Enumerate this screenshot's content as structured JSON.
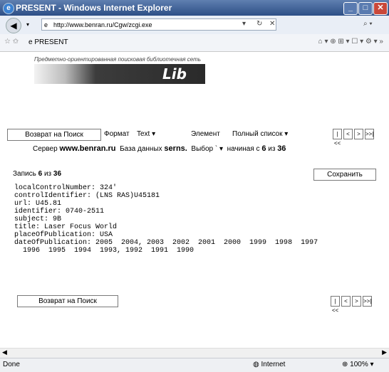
{
  "window": {
    "title": "PRESENT - Windows Internet Explorer"
  },
  "address_bar": {
    "url": "http://www.benran.ru/Cgw/zcgi.exe"
  },
  "tab": {
    "label": "PRESENT"
  },
  "page": {
    "slogan": "Предметно-ориентированная поисковая библиотечная сеть",
    "logo_text": "Lib",
    "back_button": "Возврат на Поиск",
    "format_label": "Формат",
    "format_value": "Text",
    "element_label": "Элемент",
    "element_value": "Полный список",
    "pager": [
      "|<<",
      "<",
      ">",
      ">>|"
    ],
    "server_label": "Сервер",
    "server_value": "www.benran.ru",
    "db_label": "База данных",
    "db_value": "serns.",
    "select_label": "Выбор",
    "start_label": "начиная с",
    "start_value": "6",
    "of_label": "из",
    "total_value": "36",
    "record_label": "Запись",
    "record_num": "6",
    "record_of": "из",
    "record_total": "36",
    "save_button": "Сохранить",
    "record_lines": [
      "localControlNumber: 324'",
      "controlIdentifier: (LNS RAS)U45181",
      "url: U45.81",
      "identifier: 0740-2511",
      "subject: 9B",
      "title: Laser Focus World",
      "placeOfPublication: USA",
      "dateOfPublication: 2005  2004, 2003  2002  2001  2000  1999  1998  1997",
      "  1996  1995  1994  1993, 1992  1991  1990"
    ],
    "back_button_bottom": "Возврат на Поиск"
  },
  "status": {
    "left": "Done",
    "zone": "Internet",
    "zoom": "100%"
  }
}
